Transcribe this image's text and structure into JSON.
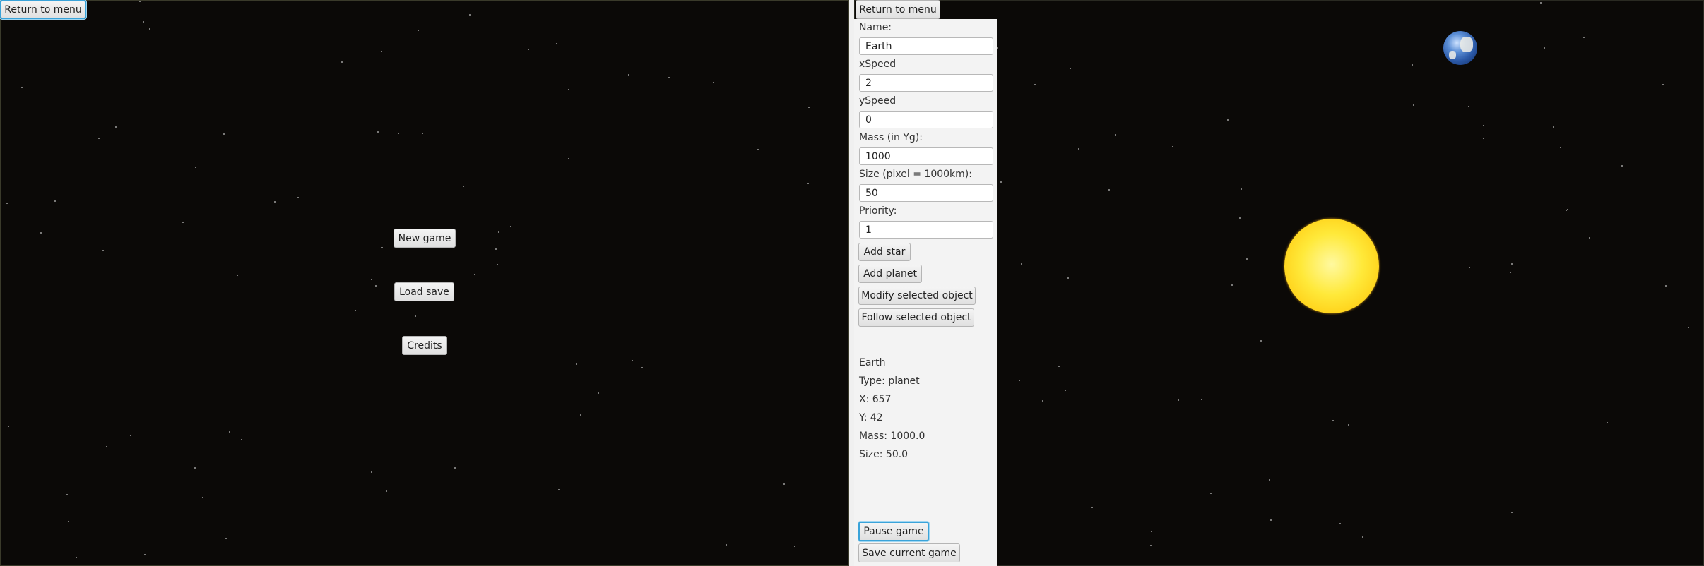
{
  "left_pane": {
    "return_label": "Return to menu",
    "menu": {
      "new_game": "New game",
      "load_save": "Load save",
      "credits": "Credits"
    }
  },
  "right_pane": {
    "return_label": "Return to menu",
    "form": {
      "name_label": "Name:",
      "name_value": "Earth",
      "xspeed_label": "xSpeed",
      "xspeed_value": "2",
      "yspeed_label": "ySpeed",
      "yspeed_value": "0",
      "mass_label": "Mass (in Yg):",
      "mass_value": "1000",
      "size_label": "Size (pixel = 1000km):",
      "size_value": "50",
      "priority_label": "Priority:",
      "priority_value": "1"
    },
    "actions": {
      "add_star": "Add star",
      "add_planet": "Add planet",
      "modify": "Modify selected object",
      "follow": "Follow selected object"
    },
    "selected_info": {
      "name": "Earth",
      "type": "Type: planet",
      "x": "X: 657",
      "y": "Y: 42",
      "mass": "Mass: 1000.0",
      "size": "Size: 50.0"
    },
    "bottom": {
      "pause": "Pause game",
      "save": "Save current game"
    },
    "scene": {
      "bodies": [
        "sun",
        "earth"
      ],
      "colors": {
        "sun": "#ffe93a",
        "earth": "#2c5aa8"
      }
    }
  },
  "colors": {
    "space": "#0b0907",
    "panel": "#f3f3f3",
    "focus": "#3aa3d9"
  }
}
